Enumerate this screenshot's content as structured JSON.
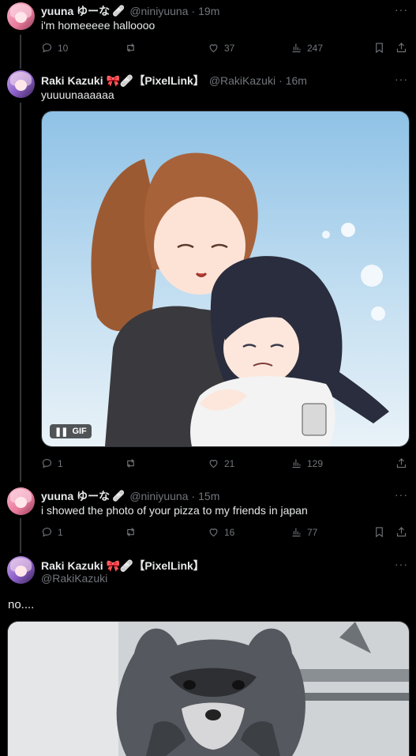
{
  "tweets": [
    {
      "author": "yuuna ゆーな",
      "emoji": "🩹",
      "handle": "@niniyuuna",
      "sep": "·",
      "time": "19m",
      "text": "i'm homeeeee halloooo",
      "replies": "10",
      "reposts": "",
      "likes": "37",
      "views": "247"
    },
    {
      "author": "Raki Kazuki 🎀🩹【PixelLink】",
      "emoji": "",
      "handle": "@RakiKazuki",
      "sep": "·",
      "time": "16m",
      "text": "yuuuunaaaaaa",
      "media_badge": "GIF",
      "replies": "1",
      "reposts": "",
      "likes": "21",
      "views": "129"
    },
    {
      "author": "yuuna ゆーな",
      "emoji": "🩹",
      "handle": "@niniyuuna",
      "sep": "·",
      "time": "15m",
      "text": "i showed the photo of your pizza to my friends in japan",
      "replies": "1",
      "reposts": "",
      "likes": "16",
      "views": "77"
    },
    {
      "author": "Raki Kazuki 🎀🩹【PixelLink】",
      "handle": "@RakiKazuki",
      "text": "no...."
    }
  ],
  "more_label": "···",
  "icons": [
    "reply-icon",
    "repost-icon",
    "like-icon",
    "views-icon",
    "bookmark-icon",
    "share-icon",
    "pause-icon"
  ],
  "colors": {
    "background": "#000000",
    "text": "#e7e9ea",
    "muted": "#71767b",
    "thread_line": "#333639"
  }
}
